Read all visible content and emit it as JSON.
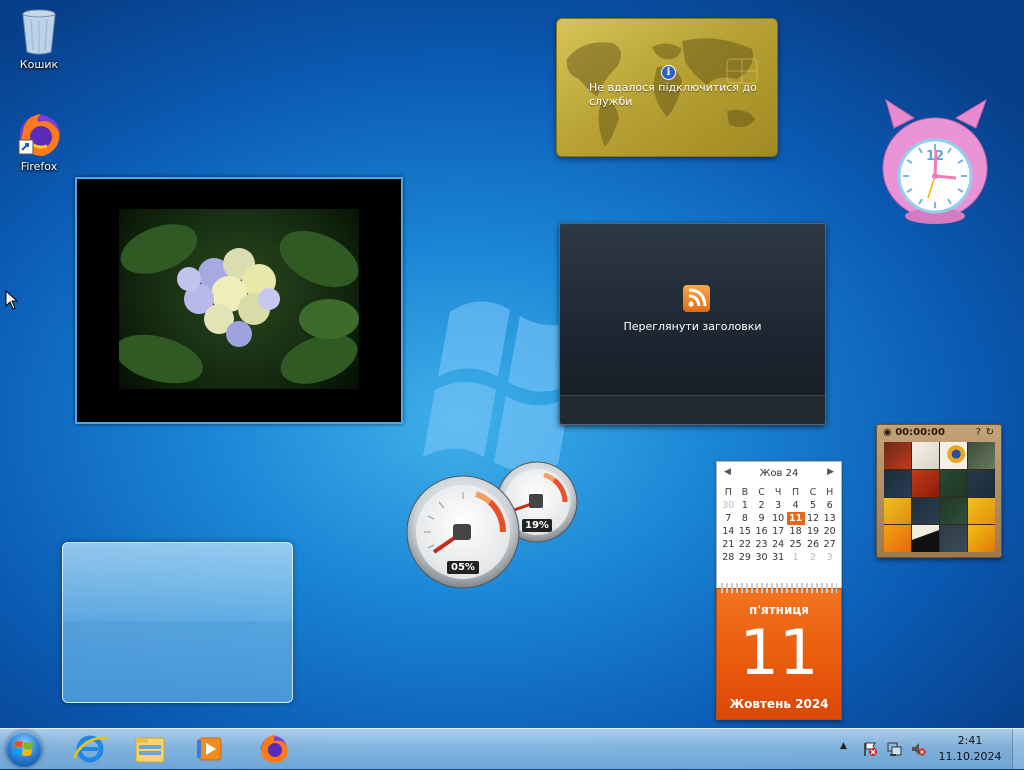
{
  "desktop": {
    "icons": [
      {
        "label": "Кошик",
        "icon": "recycle-bin-icon"
      },
      {
        "label": "Firefox",
        "icon": "firefox-icon"
      }
    ]
  },
  "gadgets": {
    "currency": {
      "message": "Не вдалося підключитися до служби",
      "icon": "info-icon"
    },
    "feed": {
      "label": "Переглянути заголовки",
      "icon": "rss-icon"
    },
    "puzzle": {
      "timer": "00:00:00"
    },
    "meter": {
      "cpu": "05%",
      "memory": "19%",
      "cpu_level": 0.05,
      "memory_level": 0.19
    },
    "clock": {
      "numeral": "12"
    },
    "calendar": {
      "month_year": "Жов 24",
      "days_of_week": [
        "П",
        "В",
        "С",
        "Ч",
        "П",
        "С",
        "Н"
      ],
      "weeks": [
        [
          "30",
          "1",
          "2",
          "3",
          "4",
          "5",
          "6"
        ],
        [
          "7",
          "8",
          "9",
          "10",
          "11",
          "12",
          "13"
        ],
        [
          "14",
          "15",
          "16",
          "17",
          "18",
          "19",
          "20"
        ],
        [
          "21",
          "22",
          "23",
          "24",
          "25",
          "26",
          "27"
        ],
        [
          "28",
          "29",
          "30",
          "31",
          "1",
          "2",
          "3"
        ]
      ],
      "today": "11",
      "weekday": "п'ятниця",
      "day": "11",
      "month_long": "Жовтень 2024"
    }
  },
  "taskbar": {
    "pinned": [
      {
        "name": "internet-explorer-icon"
      },
      {
        "name": "file-explorer-icon"
      },
      {
        "name": "media-player-icon"
      },
      {
        "name": "firefox-icon"
      }
    ],
    "tray": {
      "show_hidden": "▲",
      "time": "2:41",
      "date": "11.10.2024"
    }
  },
  "colors": {
    "accent": "#e8590c",
    "taskbar": "#9ec7e8"
  }
}
